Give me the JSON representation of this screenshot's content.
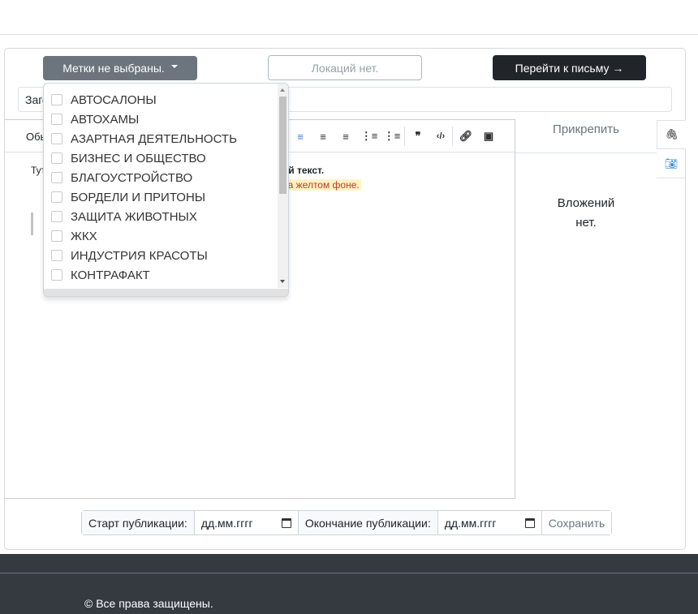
{
  "toolbar_row": {
    "tags_label": "Метки не выбраны.",
    "locations_label": "Локаций нет.",
    "go_label": "Перейти к письму →"
  },
  "subject": {
    "value": "Заголовок"
  },
  "editor": {
    "toolbar_label": "Обычный",
    "line1": "Тут",
    "bold_text": "ый текст.",
    "highlight_text": "на желтом фоне.",
    "highlight_color": "#c0392b"
  },
  "attachments": {
    "header": "Прикрепить",
    "empty_line1": "Вложений",
    "empty_line2": "нет."
  },
  "publication": {
    "start_label": "Старт публикации:",
    "start_placeholder": "дд.мм.гггг",
    "end_label": "Окончание публикации:",
    "end_placeholder": "дд.мм.гггг",
    "save_label": "Сохранить"
  },
  "tags_dropdown": {
    "items": [
      "АВТОСАЛОНЫ",
      "АВТОХАМЫ",
      "АЗАРТНАЯ ДЕЯТЕЛЬНОСТЬ",
      "БИЗНЕС И ОБЩЕСТВО",
      "БЛАГОУСТРОЙСТВО",
      "БОРДЕЛИ И ПРИТОНЫ",
      "ЗАЩИТА ЖИВОТНЫХ",
      "ЖКХ",
      "ИНДУСТРИЯ КРАСОТЫ",
      "КОНТРАФАКТ"
    ]
  },
  "footer": {
    "copyright": "© Все права защищены."
  },
  "colors": {
    "primary_dark": "#212529",
    "secondary": "#6c757d",
    "footer_bg": "#343a40"
  }
}
